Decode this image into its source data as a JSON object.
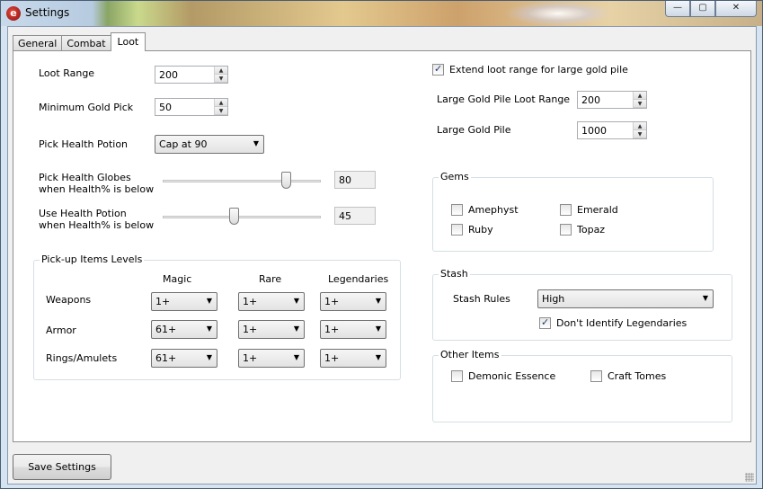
{
  "window": {
    "title": "Settings",
    "icon": "app-logo-icon"
  },
  "caption_buttons": {
    "minimize": "—",
    "maximize": "▢",
    "close": "✕"
  },
  "tabs": [
    {
      "label": "General",
      "active": false
    },
    {
      "label": "Combat",
      "active": false
    },
    {
      "label": "Loot",
      "active": true
    }
  ],
  "loot": {
    "loot_range": {
      "label": "Loot Range",
      "value": "200"
    },
    "min_gold": {
      "label": "Minimum Gold Pick",
      "value": "50"
    },
    "pick_health_potion": {
      "label": "Pick Health Potion",
      "value": "Cap at 90"
    },
    "health_globes": {
      "label1": "Pick Health Globes",
      "label2": "when Health% is below",
      "value": "80",
      "fraction": 0.8
    },
    "use_potion": {
      "label1": "Use Health Potion",
      "label2": "when Health% is below",
      "value": "45",
      "fraction": 0.45
    },
    "extend_range": {
      "label": "Extend loot range for large gold pile",
      "checked": true
    },
    "large_gold_range": {
      "label": "Large Gold Pile Loot Range",
      "value": "200"
    },
    "large_gold_pile": {
      "label": "Large Gold Pile",
      "value": "1000"
    }
  },
  "items_levels": {
    "legend": "Pick-up Items Levels",
    "columns": [
      "Magic",
      "Rare",
      "Legendaries"
    ],
    "rows": [
      {
        "label": "Weapons",
        "values": [
          "1+",
          "1+",
          "1+"
        ]
      },
      {
        "label": "Armor",
        "values": [
          "61+",
          "1+",
          "1+"
        ]
      },
      {
        "label": "Rings/Amulets",
        "values": [
          "61+",
          "1+",
          "1+"
        ]
      }
    ]
  },
  "gems": {
    "legend": "Gems",
    "items": [
      {
        "label": "Amephyst",
        "checked": false
      },
      {
        "label": "Emerald",
        "checked": false
      },
      {
        "label": "Ruby",
        "checked": false
      },
      {
        "label": "Topaz",
        "checked": false
      }
    ]
  },
  "stash": {
    "legend": "Stash",
    "rules_label": "Stash Rules",
    "rules_value": "High",
    "dont_identify": {
      "label": "Don't Identify Legendaries",
      "checked": true
    }
  },
  "other_items": {
    "legend": "Other Items",
    "items": [
      {
        "label": "Demonic Essence",
        "checked": false
      },
      {
        "label": "Craft Tomes",
        "checked": false
      }
    ]
  },
  "footer": {
    "save_label": "Save Settings"
  }
}
